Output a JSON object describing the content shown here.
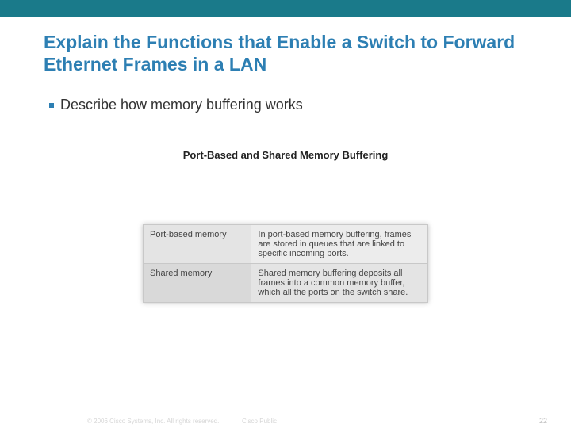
{
  "title": "Explain the Functions that Enable a Switch to Forward Ethernet Frames in a LAN",
  "bullet": "Describe how memory buffering works",
  "figure": {
    "caption": "Port-Based and Shared Memory Buffering",
    "rows": [
      {
        "label": "Port-based memory",
        "desc": "In port-based memory buffering, frames are stored in queues that are linked to specific incoming ports."
      },
      {
        "label": "Shared memory",
        "desc": "Shared memory buffering deposits all frames into a common memory buffer, which all the ports on the switch share."
      }
    ]
  },
  "footer": {
    "copyright": "© 2006 Cisco Systems, Inc. All rights reserved.",
    "public": "Cisco Public",
    "page": "22"
  }
}
